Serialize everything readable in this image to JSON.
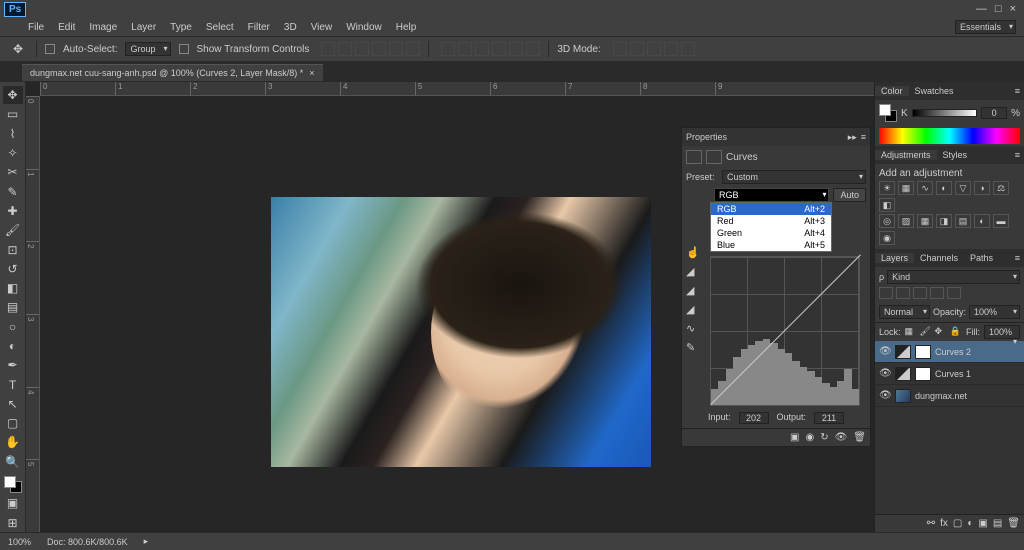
{
  "app": {
    "logo": "Ps"
  },
  "window_controls": {
    "min": "—",
    "max": "□",
    "close": "×"
  },
  "menu": [
    "File",
    "Edit",
    "Image",
    "Layer",
    "Type",
    "Select",
    "Filter",
    "3D",
    "View",
    "Window",
    "Help"
  ],
  "options": {
    "auto_select": "Auto-Select:",
    "auto_select_val": "Group",
    "show_transform": "Show Transform Controls",
    "mode_3d": "3D Mode:"
  },
  "workspace": "Essentials",
  "doc_tab": "dungmax.net cuu-sang-anh.psd @ 100% (Curves 2, Layer Mask/8) *",
  "ruler_h": [
    "0",
    "1",
    "2",
    "3",
    "4",
    "5",
    "6",
    "7",
    "8",
    "9"
  ],
  "ruler_v": [
    "0",
    "1",
    "2",
    "3",
    "4",
    "5"
  ],
  "properties": {
    "title": "Properties",
    "type": "Curves",
    "preset_label": "Preset:",
    "preset_value": "Custom",
    "channel_value": "RGB",
    "auto_btn": "Auto",
    "channels": [
      {
        "name": "RGB",
        "key": "Alt+2",
        "sel": true
      },
      {
        "name": "Red",
        "key": "Alt+3",
        "sel": false
      },
      {
        "name": "Green",
        "key": "Alt+4",
        "sel": false
      },
      {
        "name": "Blue",
        "key": "Alt+5",
        "sel": false
      }
    ],
    "input_label": "Input:",
    "input_value": "202",
    "output_label": "Output:",
    "output_value": "211"
  },
  "color_panel": {
    "tabs": [
      "Color",
      "Swatches"
    ],
    "channel": "K",
    "value": "0",
    "unit": "%"
  },
  "adjustments": {
    "tabs": [
      "Adjustments",
      "Styles"
    ],
    "label": "Add an adjustment"
  },
  "layers": {
    "tabs": [
      "Layers",
      "Channels",
      "Paths"
    ],
    "kind": "Kind",
    "blend": "Normal",
    "opacity_label": "Opacity:",
    "opacity_value": "100%",
    "lock_label": "Lock:",
    "fill_label": "Fill:",
    "fill_value": "100%",
    "items": [
      {
        "name": "Curves 2",
        "type": "curves",
        "sel": true
      },
      {
        "name": "Curves 1",
        "type": "curves",
        "sel": false
      },
      {
        "name": "dungmax.net",
        "type": "photo",
        "sel": false
      }
    ]
  },
  "status": {
    "zoom": "100%",
    "doc": "Doc: 800.6K/800.6K"
  }
}
